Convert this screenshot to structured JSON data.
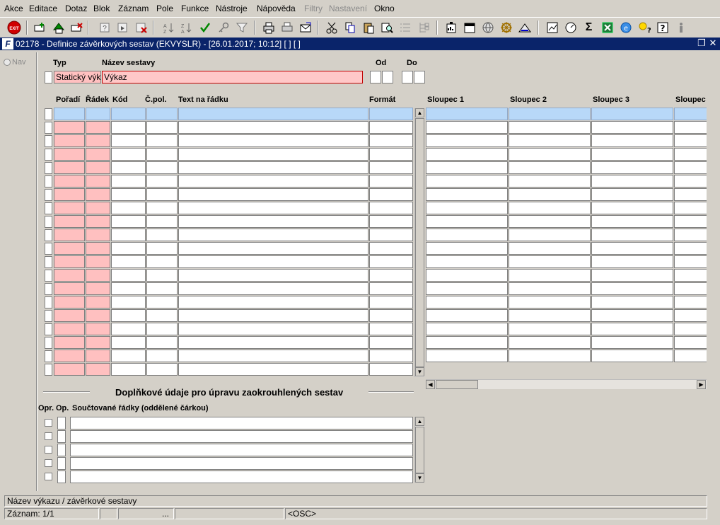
{
  "menu": [
    "Akce",
    "Editace",
    "Dotaz",
    "Blok",
    "Záznam",
    "Pole",
    "Funkce",
    "Nástroje",
    "Nápověda",
    "Filtry",
    "Nastavení",
    "Okno"
  ],
  "toolbar": {
    "exit_label": "EXIT",
    "icons": [
      "add-record-icon",
      "save-icon",
      "delete-record-icon",
      "query-icon",
      "run-query-icon",
      "cancel-query-icon",
      "sort-asc-icon",
      "sort-desc-icon",
      "confirm-icon",
      "key-icon",
      "filter-icon",
      "print-icon",
      "print-preview-icon",
      "mail-icon",
      "cut-icon",
      "copy-icon",
      "paste-icon",
      "find-icon",
      "list-icon",
      "tree-icon",
      "report-icon",
      "calendar-icon",
      "globe-icon",
      "wheel-icon",
      "chart-icon",
      "edit-chart-icon",
      "settings-dial-icon",
      "sum-icon",
      "excel-icon",
      "ie-icon",
      "help-lamp-icon",
      "help-icon",
      "info-icon"
    ]
  },
  "window": {
    "title": "02178 - Definice závěrkových sestav (EKVYSLR) - [26.01.2017; 10:12]  [ ] [ ]",
    "icon_label": "F"
  },
  "nav": {
    "label": "Nav"
  },
  "header": {
    "typ_label": "Typ",
    "nazev_label": "Název sestavy",
    "od_label": "Od",
    "do_label": "Do",
    "typ_value": "Statický výka",
    "nazev_value": "Výkaz"
  },
  "grid": {
    "columns": [
      "Pořadí",
      "Řádek",
      "Kód",
      "Č.pol.",
      "Text na řádku",
      "Formát"
    ],
    "sloupce": [
      "Sloupec 1",
      "Sloupec 2",
      "Sloupec 3",
      "Sloupec"
    ]
  },
  "extra": {
    "title": "Doplňkové údaje pro úpravu zaokrouhlených sestav",
    "col_opr": "Opr.",
    "col_op": "Op.",
    "col_rows": "Součtované řádky (oddělené čárkou)"
  },
  "status": {
    "hint": "Název výkazu / závěrkové sestavy",
    "record": "Záznam: 1/1",
    "dots": "...",
    "mode": "<OSC>"
  }
}
